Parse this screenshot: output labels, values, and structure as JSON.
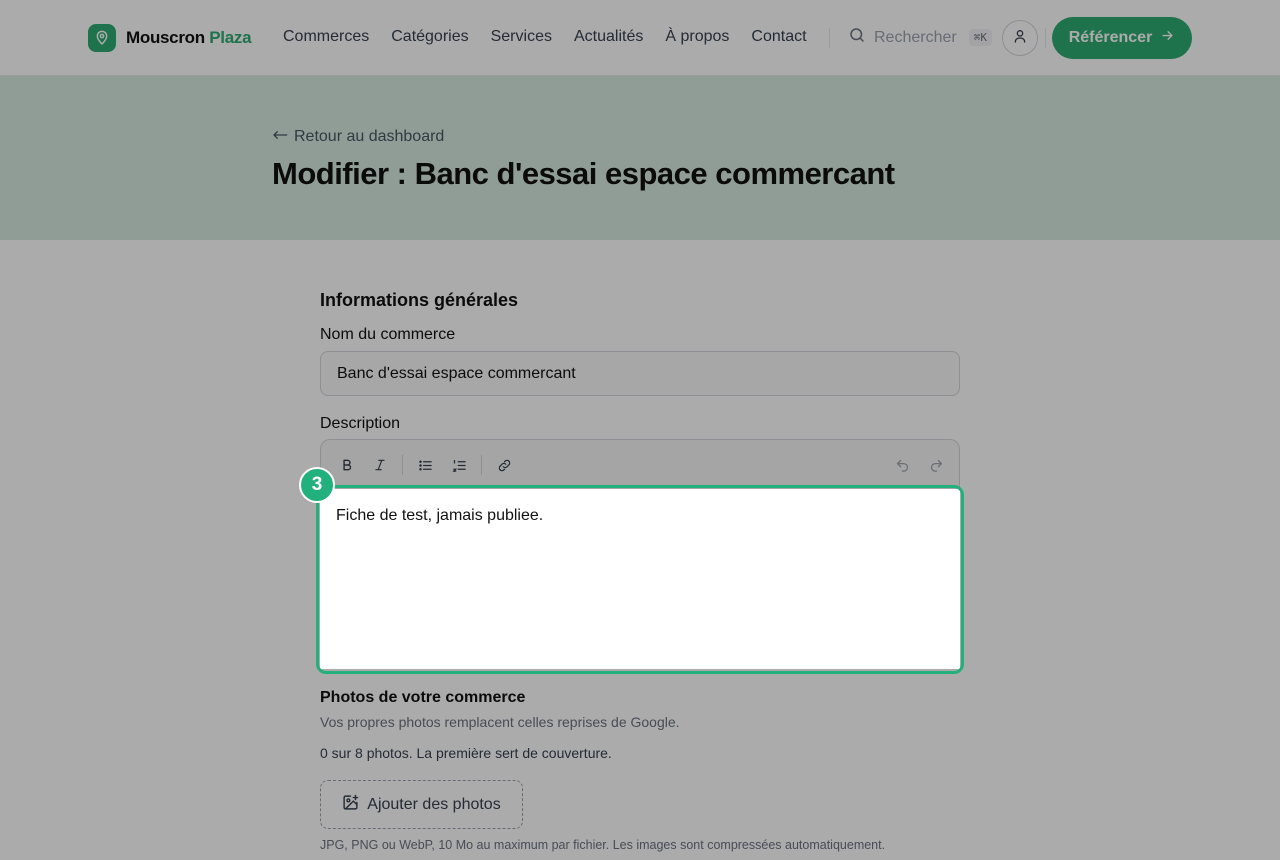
{
  "header": {
    "brand_part1": "Mouscron",
    "brand_part2": "Plaza",
    "nav": [
      "Commerces",
      "Catégories",
      "Services",
      "Actualités",
      "À propos",
      "Contact"
    ],
    "search_placeholder": "Rechercher",
    "search_shortcut": "⌘K",
    "cta_label": "Référencer",
    "brand_color": "#2eaa72"
  },
  "hero": {
    "back_link": "Retour au dashboard",
    "title": "Modifier : Banc d'essai espace commercant"
  },
  "form": {
    "section_title": "Informations générales",
    "name_label": "Nom du commerce",
    "name_value": "Banc d'essai espace commercant",
    "description_label": "Description",
    "description_value": "Fiche de test, jamais publiee.",
    "step_number": "3",
    "toolbar_icons": [
      "bold-icon",
      "italic-icon",
      "bullet-list-icon",
      "numbered-list-icon",
      "link-icon",
      "undo-icon",
      "redo-icon"
    ],
    "photos_label": "Photos de votre commerce",
    "photos_hint": "Vos propres photos remplacent celles reprises de Google.",
    "photos_count": "0 sur 8 photos. La première sert de couverture.",
    "add_photos_label": "Ajouter des photos",
    "file_rules": "JPG, PNG ou WebP, 10 Mo au maximum par fichier. Les images sont compressées automatiquement."
  }
}
